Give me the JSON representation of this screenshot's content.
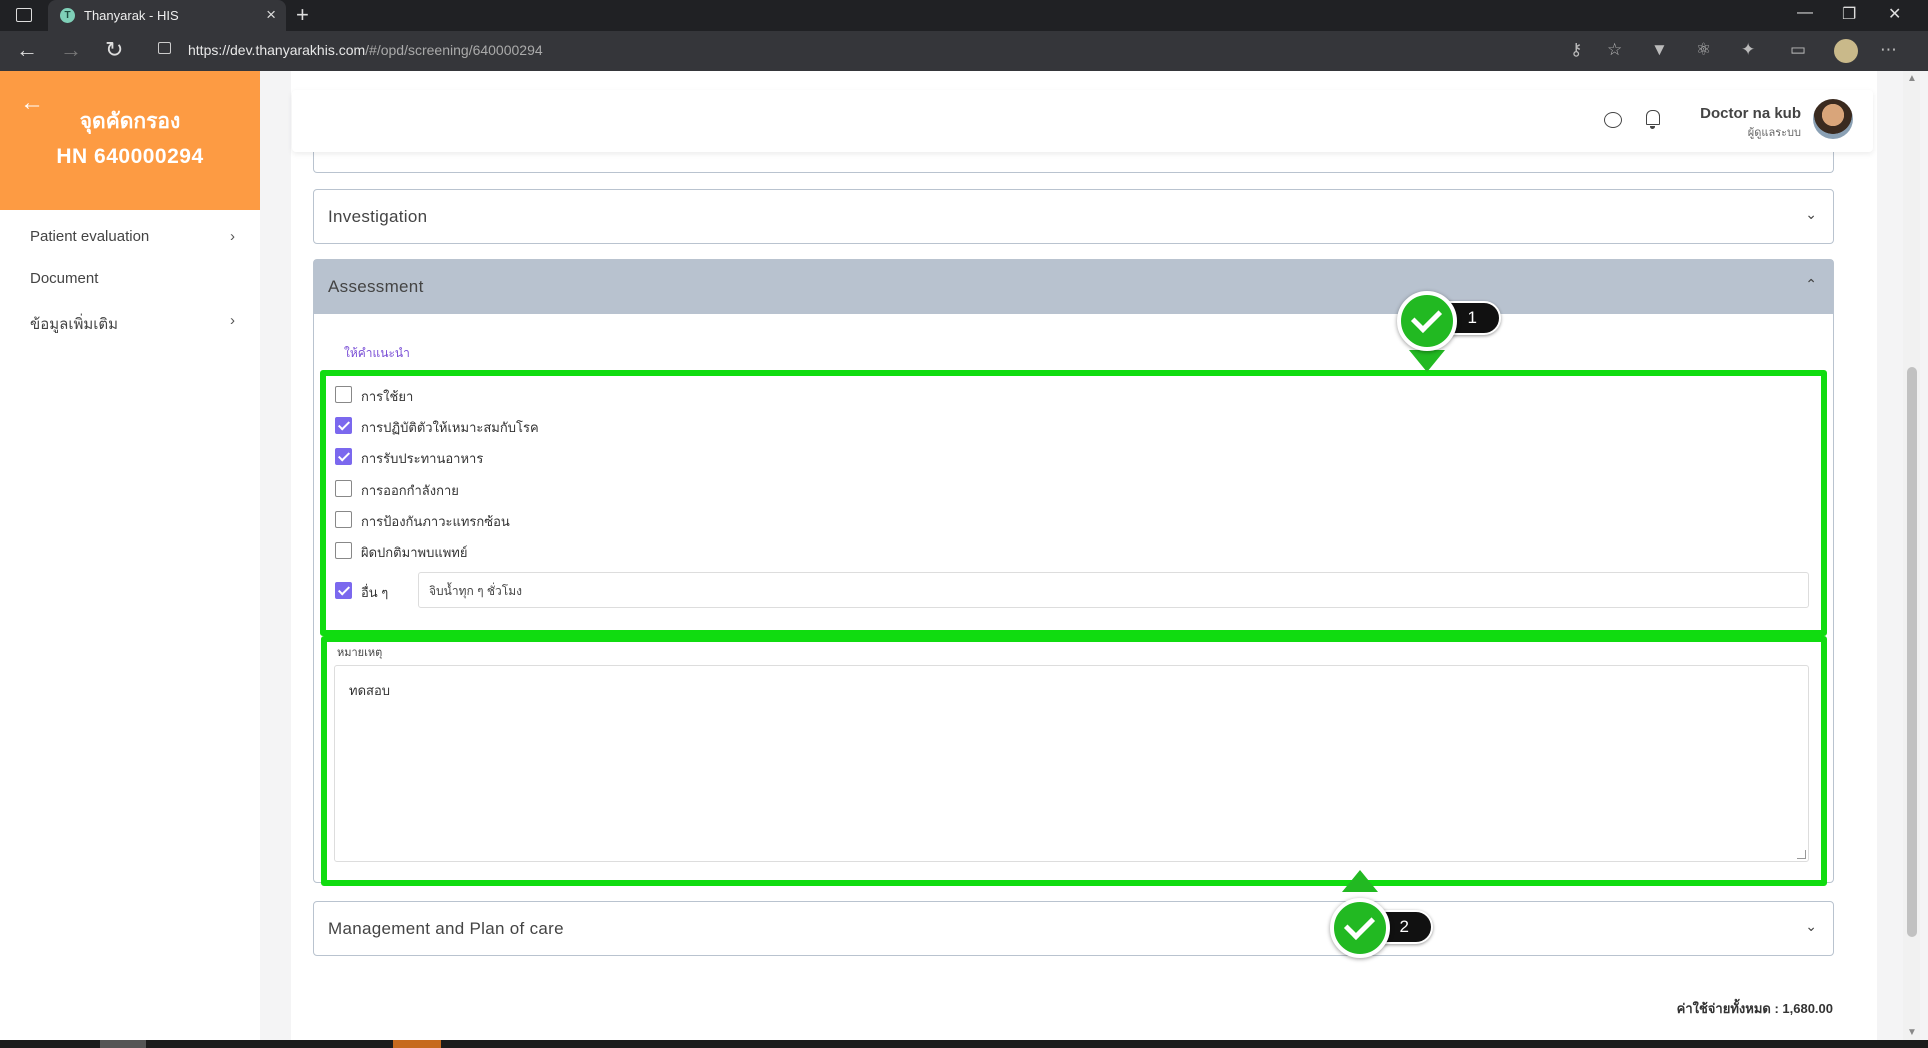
{
  "browser": {
    "tab_title": "Thanyarak - HIS",
    "url_main": "https://dev.thanyarakhis.com",
    "url_path": "/#/opd/screening/640000294"
  },
  "sidebar": {
    "title": "จุดคัดกรอง",
    "hn": "HN 640000294",
    "items": [
      {
        "label": "Patient evaluation",
        "has_chevron": true
      },
      {
        "label": "Document",
        "has_chevron": false
      },
      {
        "label": "ข้อมูลเพิ่มเติม",
        "has_chevron": true
      }
    ]
  },
  "header": {
    "user_name": "Doctor na kub",
    "user_role": "ผู้ดูแลระบบ"
  },
  "sections": {
    "investigation": "Investigation",
    "assessment": "Assessment",
    "management": "Management and Plan of care"
  },
  "assessment": {
    "advice_label": "ให้คำแนะนำ",
    "options": [
      {
        "label": "การใช้ยา",
        "checked": false
      },
      {
        "label": "การปฏิบัติตัวให้เหมาะสมกับโรค",
        "checked": true
      },
      {
        "label": "การรับประทานอาหาร",
        "checked": true
      },
      {
        "label": "การออกกำลังกาย",
        "checked": false
      },
      {
        "label": "การป้องกันภาวะแทรกซ้อน",
        "checked": false
      },
      {
        "label": "ผิดปกติมาพบแพทย์",
        "checked": false
      },
      {
        "label": "อื่น ๆ",
        "checked": true
      }
    ],
    "other_value": "จิบน้ำทุก ๆ ชั่วโมง",
    "note_label": "หมายเหตุ",
    "note_value": "ทดสอบ"
  },
  "annotations": {
    "badge_1": "1",
    "badge_2": "2",
    "highlight_color": "#10dc10"
  },
  "footer": {
    "total": "ค่าใช้จ่ายทั้งหมด : 1,680.00"
  },
  "colors": {
    "sidebar_header": "#fd9b43",
    "checkbox_checked": "#7b68ee",
    "section_open_header": "#b8c2cf"
  }
}
